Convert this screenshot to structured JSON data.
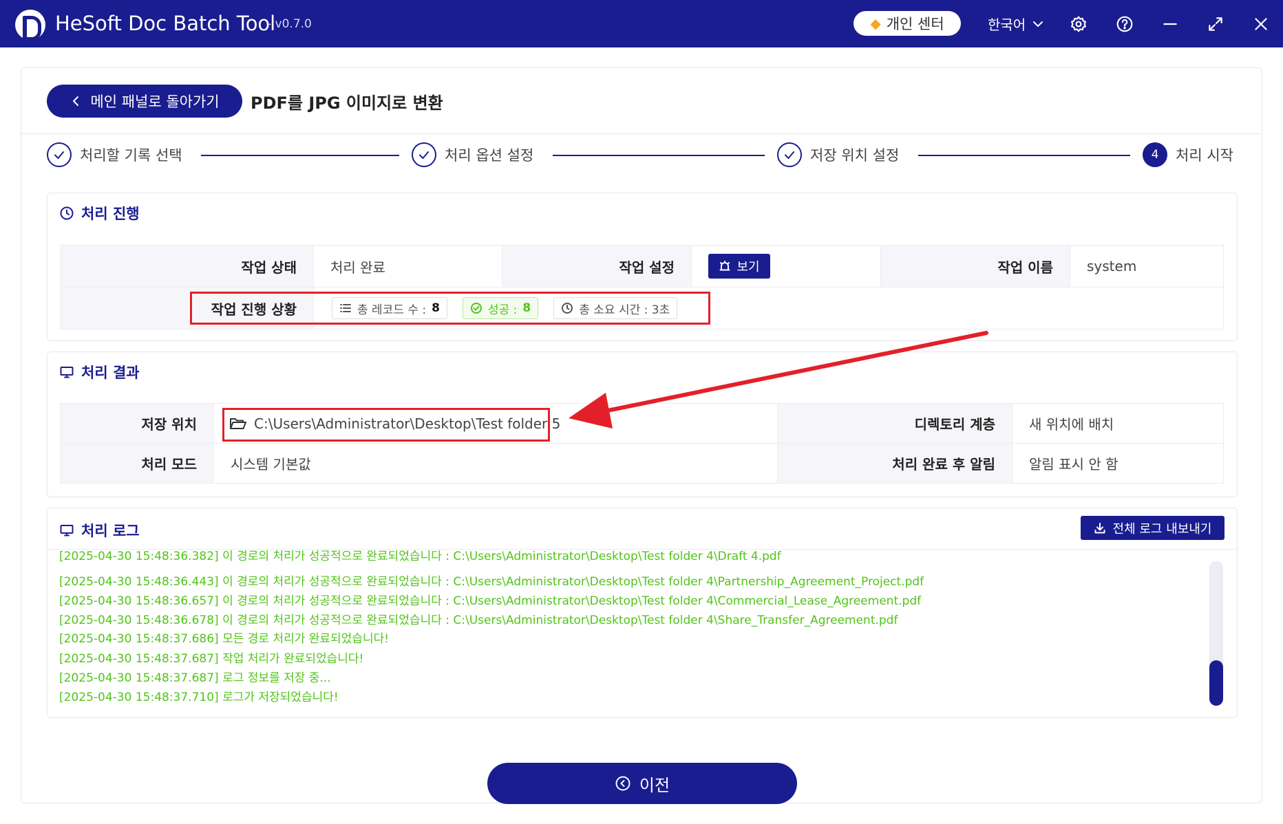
{
  "app": {
    "title": "HeSoft Doc Batch Tool",
    "version": "- v0.7.0",
    "user_center": "개인 센터",
    "language": "한국어"
  },
  "header": {
    "back_label": "메인 패널로 돌아가기",
    "page_title": "PDF를 JPG 이미지로 변환"
  },
  "steps": [
    {
      "label": "처리할 기록 선택",
      "done": true
    },
    {
      "label": "처리 옵션 설정",
      "done": true
    },
    {
      "label": "저장 위치 설정",
      "done": true
    },
    {
      "label": "처리 시작",
      "number": "4",
      "active": true
    }
  ],
  "progress": {
    "title": "처리 진행",
    "status_label": "작업 상태",
    "status_value": "처리 완료",
    "settings_label": "작업 설정",
    "view_label": "보기",
    "name_label": "작업 이름",
    "name_value": "system",
    "progress_label": "작업 진행 상황",
    "total_records": "총 레코드 수 :",
    "total_records_value": "8",
    "success": "성공 :",
    "success_value": "8",
    "total_time": "총 소요 시간 : 3초"
  },
  "result": {
    "title": "처리 결과",
    "save_label": "저장 위치",
    "save_path": "C:\\Users\\Administrator\\Desktop\\Test folder 5",
    "dir_label": "디렉토리 계층",
    "dir_value": "새 위치에 배치",
    "mode_label": "처리 모드",
    "mode_value": "시스템 기본값",
    "notify_label": "처리 완료 후 알림",
    "notify_value": "알림 표시 안 함"
  },
  "log": {
    "title": "처리 로그",
    "export_label": "전체 로그 내보내기",
    "lines": [
      "[2025-04-30 15:48:36.382] 이 경로의 처리가 성공적으로 완료되었습니다 : C:\\Users\\Administrator\\Desktop\\Test folder 4\\Draft 4.pdf",
      "[2025-04-30 15:48:36.443] 이 경로의 처리가 성공적으로 완료되었습니다 : C:\\Users\\Administrator\\Desktop\\Test folder 4\\Partnership_Agreement_Project.pdf",
      "[2025-04-30 15:48:36.657] 이 경로의 처리가 성공적으로 완료되었습니다 : C:\\Users\\Administrator\\Desktop\\Test folder 4\\Commercial_Lease_Agreement.pdf",
      "[2025-04-30 15:48:36.678] 이 경로의 처리가 성공적으로 완료되었습니다 : C:\\Users\\Administrator\\Desktop\\Test folder 4\\Share_Transfer_Agreement.pdf",
      "[2025-04-30 15:48:37.686] 모든 경로 처리가 완료되었습니다!",
      "[2025-04-30 15:48:37.687] 작업 처리가 완료되었습니다!",
      "[2025-04-30 15:48:37.687] 로그 정보를 저장 중...",
      "[2025-04-30 15:48:37.710] 로그가 저장되었습니다!"
    ]
  },
  "footer": {
    "prev_label": "이전"
  },
  "colors": {
    "primary": "#1a1d8f",
    "success": "#52c41a",
    "highlight": "#e3202a"
  }
}
